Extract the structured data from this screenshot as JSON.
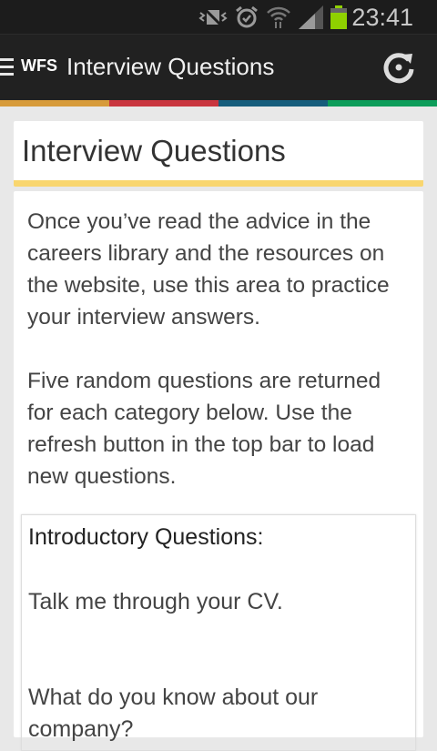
{
  "status_bar": {
    "time": "23:41",
    "icons": [
      "vibrate-silent-icon",
      "alarm-icon",
      "wifi-icon",
      "signal-icon",
      "battery-icon"
    ],
    "battery_color": "#8fd100"
  },
  "app_bar": {
    "logo": "WFS",
    "title": "Interview Questions",
    "menu_icon": "hamburger-icon",
    "action_icon": "refresh-icon"
  },
  "stripe_colors": [
    "#d79b3a",
    "#c9363f",
    "#165d7c",
    "#0d9d5a"
  ],
  "page": {
    "heading": "Interview Questions",
    "accent": "#f9d66f",
    "intro": [
      "Once you’ve read the advice in the careers library and the resources on the website, use this area to practice your interview answers.",
      "Five random questions are returned for each category below. Use the refresh button in the top bar to load new questions."
    ],
    "category": {
      "title": "Introductory Questions:",
      "questions": [
        "Talk me through your CV.",
        "What do you know about our company?"
      ]
    }
  }
}
